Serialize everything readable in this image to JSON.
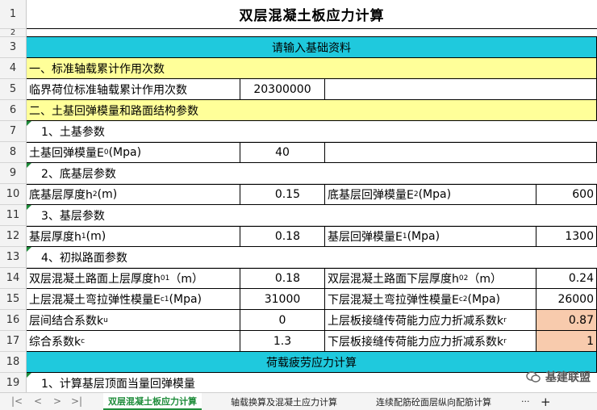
{
  "sheet": {
    "title": "双层混凝土板应力计算",
    "rows": {
      "r1": "1",
      "r2": "2",
      "r3": "3",
      "r4": "4",
      "r5": "5",
      "r6": "6",
      "r7": "7",
      "r8": "8",
      "r9": "9",
      "r10": "10",
      "r11": "11",
      "r12": "12",
      "r13": "13",
      "r14": "14",
      "r15": "15",
      "r16": "16",
      "r17": "17",
      "r18": "18",
      "r19": "19"
    },
    "r3_header": "请输入基础资料",
    "r4_section": "一、标准轴载累计作用次数",
    "r5_label": "临界荷位标准轴载累计作用次数",
    "r5_value": "20300000",
    "r6_section": "二、土基回弹模量和路面结构参数",
    "r7_sub": "1、土基参数",
    "r8_label": "土基回弹模量E",
    "r8_sub": "0",
    "r8_unit": "(Mpa)",
    "r8_value": "40",
    "r9_sub": "2、底基层参数",
    "r10_label": "底基层厚度h",
    "r10_sub": "2",
    "r10_unit": "(m)",
    "r10_value": "0.15",
    "r10_label2": "底基层回弹模量E",
    "r10_sub2": "2",
    "r10_unit2": "(Mpa)",
    "r10_value2": "600",
    "r11_sub": "3、基层参数",
    "r12_label": "基层厚度h",
    "r12_sub": "1",
    "r12_unit": "(m)",
    "r12_value": "0.18",
    "r12_label2": "基层回弹模量E",
    "r12_sub2": "1",
    "r12_unit2": "(Mpa)",
    "r12_value2": "1300",
    "r13_sub": "4、初拟路面参数",
    "r14_label": "双层混凝土路面上层厚度h",
    "r14_sub": "01",
    "r14_unit": "（m）",
    "r14_value": "0.18",
    "r14_label2": "双层混凝土路面下层厚度h",
    "r14_sub2": "02",
    "r14_unit2": "（m）",
    "r14_value2": "0.24",
    "r15_label": "上层混凝土弯拉弹性模量E",
    "r15_sub": "c1",
    "r15_unit": "(Mpa)",
    "r15_value": "31000",
    "r15_label2": "下层混凝土弯拉弹性模量E",
    "r15_sub2": "c2",
    "r15_unit2": "(Mpa)",
    "r15_value2": "26000",
    "r16_label": "层间结合系数k",
    "r16_sub": "u",
    "r16_value": "0",
    "r16_label2": "上层板接缝传荷能力应力折减系数k",
    "r16_sub2": "r",
    "r16_value2": "0.87",
    "r17_label": "综合系数k",
    "r17_sub": "c",
    "r17_value": "1.3",
    "r17_label2": "下层板接缝传荷能力应力折减系数k",
    "r17_sub2": "r",
    "r17_value2": "1",
    "r18_header": "荷载疲劳应力计算",
    "r19_sub": "1、计算基层顶面当量回弹模量"
  },
  "tabs": {
    "nav_first": "|<",
    "nav_prev": "<",
    "nav_next": ">",
    "nav_last": ">|",
    "tab1": "双层混凝土板应力计算",
    "tab2": "轴载换算及混凝土应力计算",
    "tab3": "连续配筋砼面层纵向配筋计算",
    "more": "···",
    "add": "+"
  },
  "watermark": {
    "text": "基建联盟"
  },
  "colors": {
    "header_cyan": "#1fc9dd",
    "section_yellow": "#ffff99",
    "highlight_orange": "#f8cbad",
    "active_tab_green": "#1e8c3a"
  }
}
